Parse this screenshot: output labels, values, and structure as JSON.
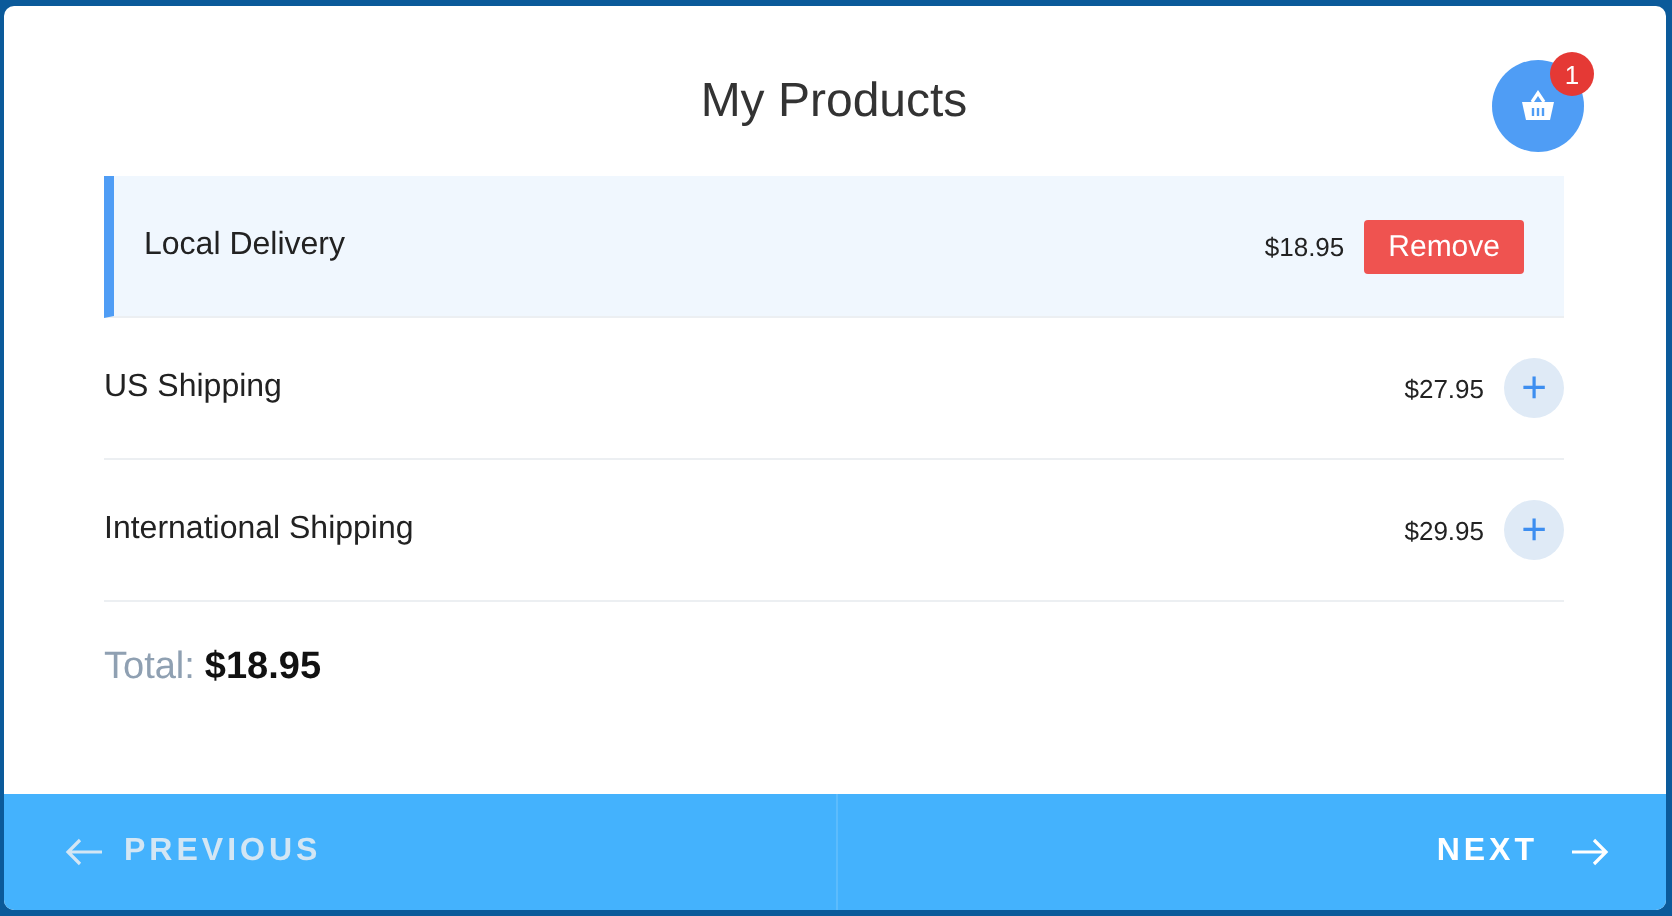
{
  "title": "My Products",
  "cart": {
    "count": "1"
  },
  "products": [
    {
      "name": "Local Delivery",
      "price": "$18.95",
      "selected": true,
      "action": "Remove"
    },
    {
      "name": "US Shipping",
      "price": "$27.95",
      "selected": false,
      "action": "+"
    },
    {
      "name": "International Shipping",
      "price": "$29.95",
      "selected": false,
      "action": "+"
    }
  ],
  "total": {
    "label": "Total:",
    "value": "$18.95"
  },
  "footer": {
    "previous": {
      "label": "PREVIOUS",
      "disabled": true
    },
    "next": {
      "label": "NEXT",
      "disabled": false
    }
  }
}
